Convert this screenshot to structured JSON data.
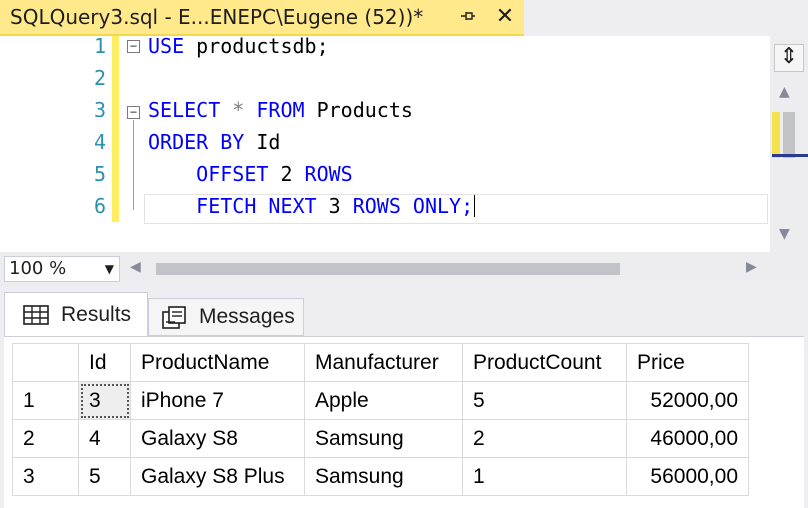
{
  "document_tab": {
    "title": "SQLQuery3.sql - E...ENEPC\\Eugene (52))*",
    "pin_icon": "pin-icon",
    "close_glyph": "✕"
  },
  "editor": {
    "lines": [
      {
        "num": "1",
        "text": "USE productsdb;"
      },
      {
        "num": "2",
        "text": ""
      },
      {
        "num": "3",
        "text": "SELECT * FROM Products"
      },
      {
        "num": "4",
        "text": "ORDER BY Id"
      },
      {
        "num": "5",
        "text": "    OFFSET 2 ROWS"
      },
      {
        "num": "6",
        "text": "    FETCH NEXT 3 ROWS ONLY;"
      }
    ],
    "tokens": {
      "use": "USE",
      "productsdb": " productsdb;",
      "select": "SELECT",
      "star": " * ",
      "from": "FROM",
      "products": " Products",
      "order_by": "ORDER BY",
      "id": " Id",
      "indent": "    ",
      "offset": "OFFSET",
      "two": " 2 ",
      "rows": "ROWS",
      "fetch_next": "FETCH NEXT",
      "three": " 3 ",
      "rows2": "ROWS",
      "only": " ONLY;"
    },
    "fold_glyph": "−"
  },
  "zoom": {
    "value": "100 %",
    "arrow": "▼"
  },
  "results": {
    "tabs": [
      {
        "label": "Results",
        "icon": "grid-icon",
        "active": true
      },
      {
        "label": "Messages",
        "icon": "messages-icon",
        "active": false
      }
    ],
    "columns": [
      "Id",
      "ProductName",
      "Manufacturer",
      "ProductCount",
      "Price"
    ],
    "rows": [
      {
        "row_num": "1",
        "Id": "3",
        "ProductName": "iPhone 7",
        "Manufacturer": "Apple",
        "ProductCount": "5",
        "Price": "52000,00"
      },
      {
        "row_num": "2",
        "Id": "4",
        "ProductName": "Galaxy S8",
        "Manufacturer": "Samsung",
        "ProductCount": "2",
        "Price": "46000,00"
      },
      {
        "row_num": "3",
        "Id": "5",
        "ProductName": "Galaxy S8 Plus",
        "Manufacturer": "Samsung",
        "ProductCount": "1",
        "Price": "56000,00"
      }
    ]
  },
  "colors": {
    "tab_accent": "#ffe98b",
    "keyword": "#0000ff",
    "line_number": "#2b91af",
    "change_marker": "#ffee62"
  }
}
